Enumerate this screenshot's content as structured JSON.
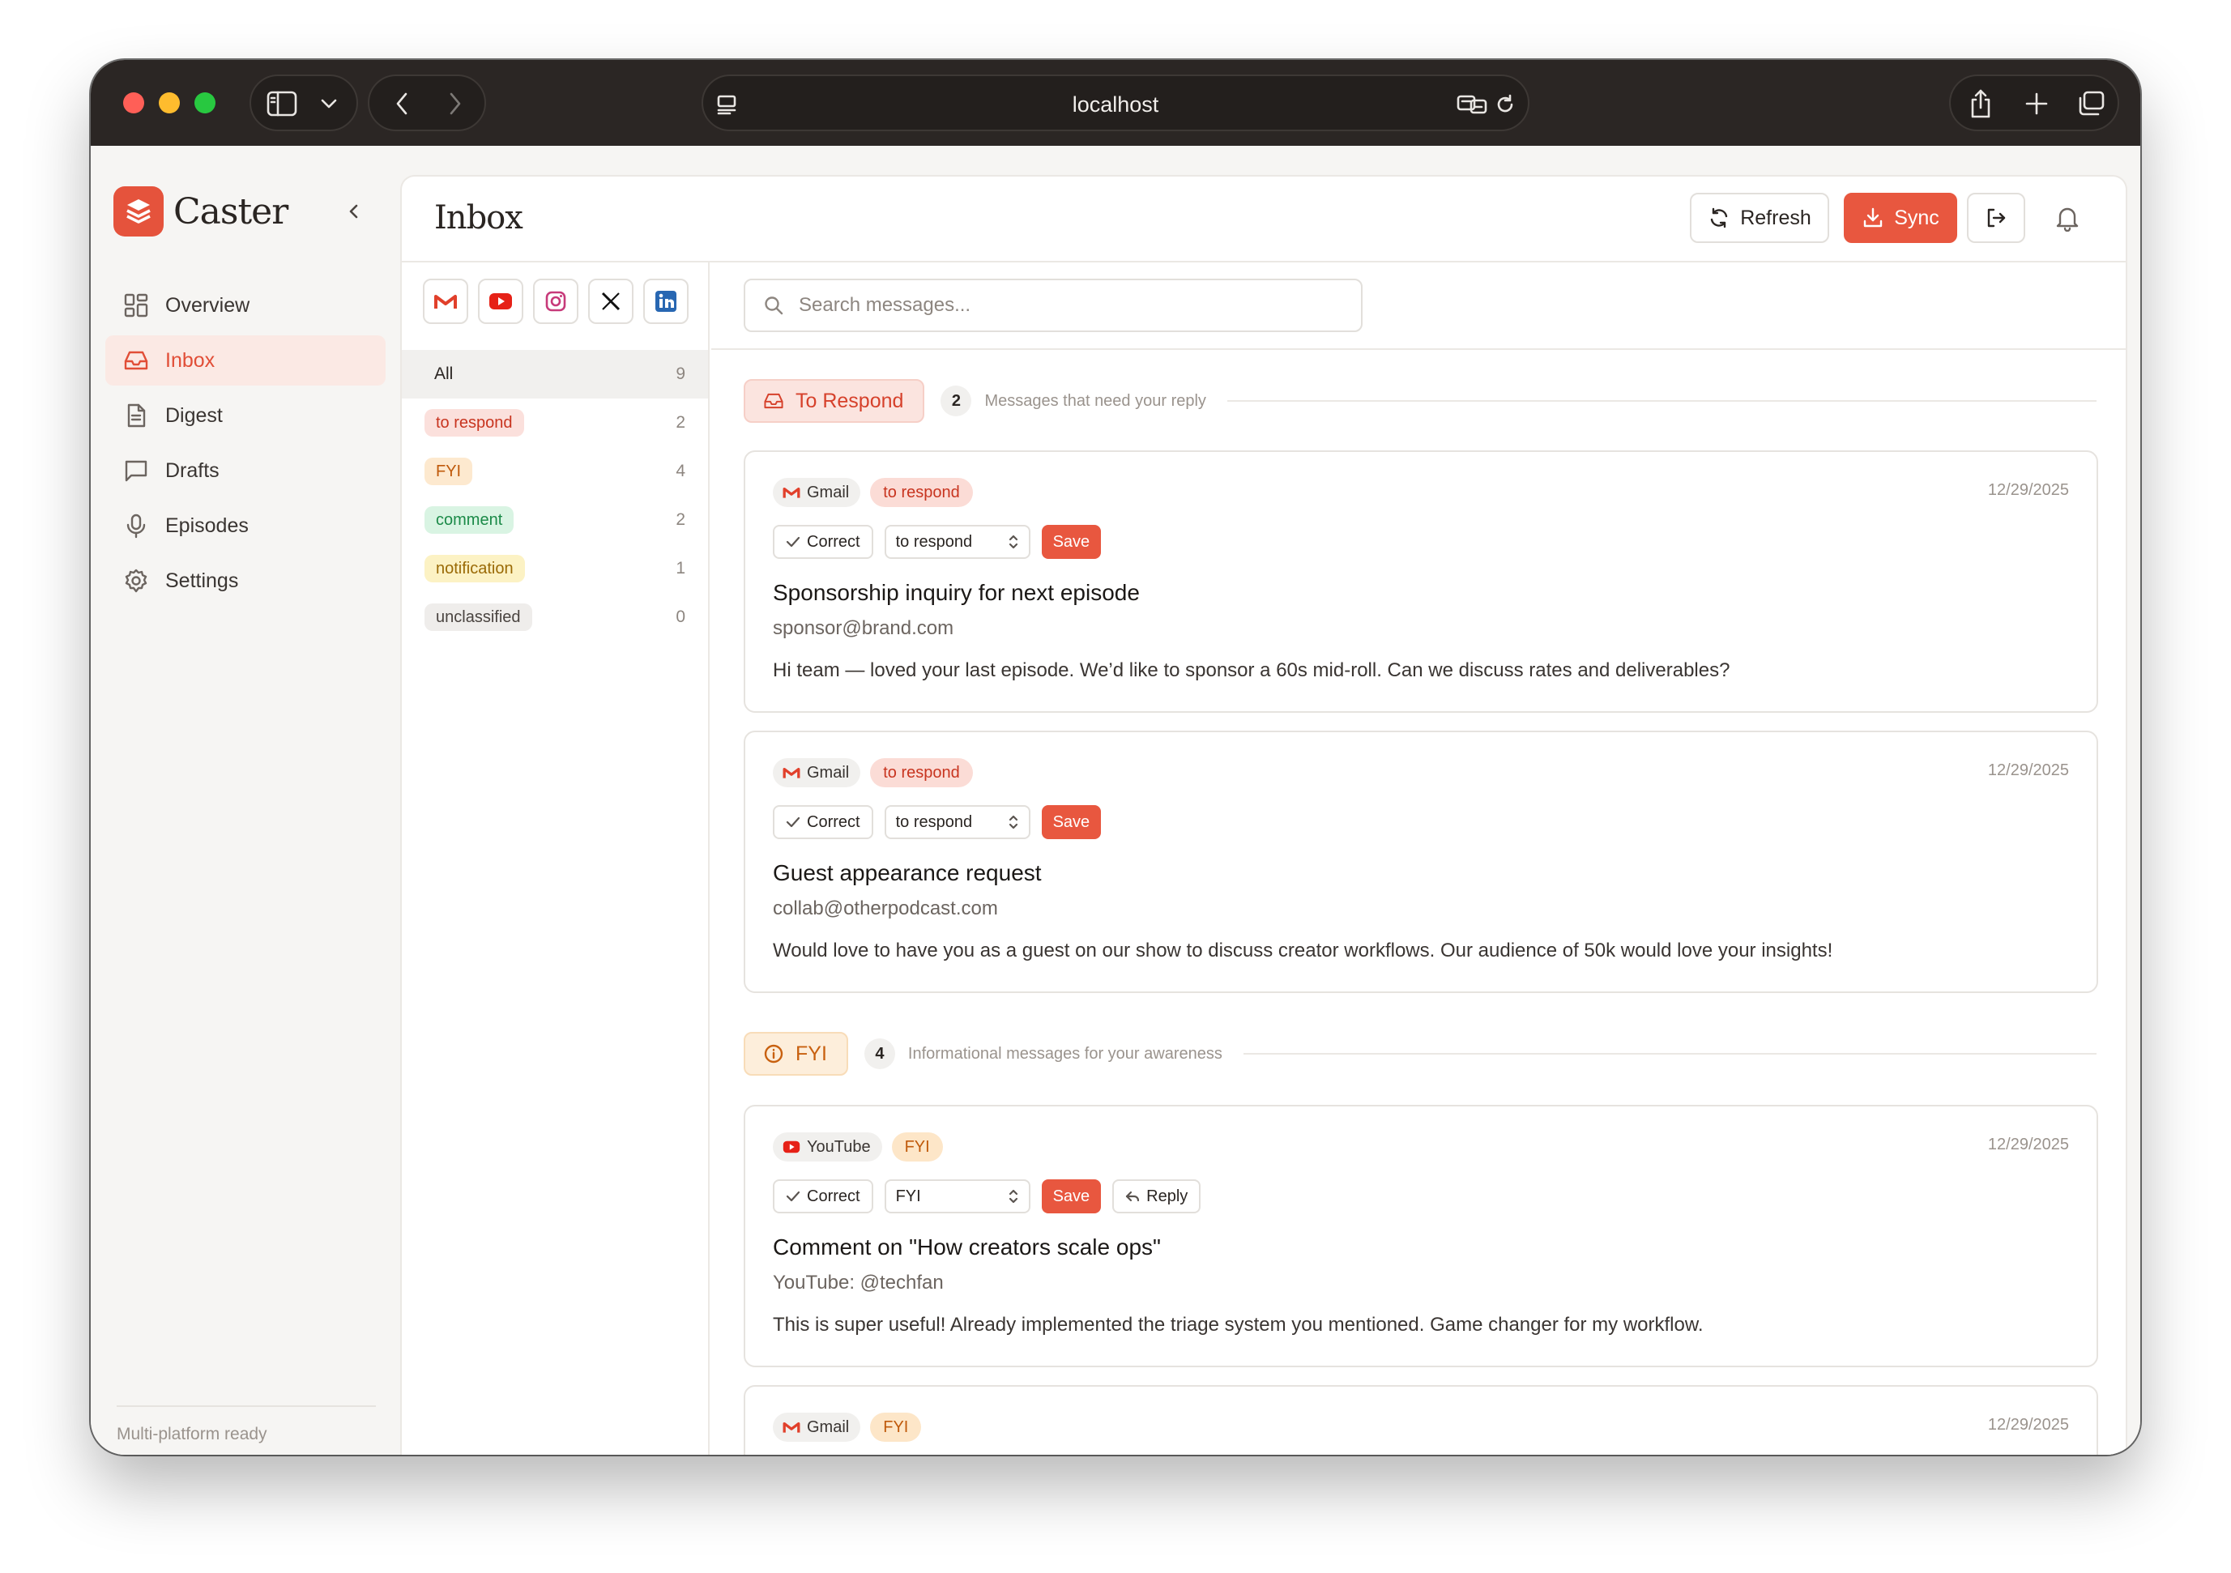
{
  "browser": {
    "url": "localhost"
  },
  "sidebar": {
    "brand": "Caster",
    "items": [
      {
        "label": "Overview",
        "icon": "grid-icon"
      },
      {
        "label": "Inbox",
        "icon": "inbox-icon",
        "active": true
      },
      {
        "label": "Digest",
        "icon": "document-icon"
      },
      {
        "label": "Drafts",
        "icon": "message-square-icon"
      },
      {
        "label": "Episodes",
        "icon": "microphone-icon"
      },
      {
        "label": "Settings",
        "icon": "gear-icon"
      }
    ],
    "footer": "Multi-platform ready"
  },
  "header": {
    "title": "Inbox",
    "refresh_label": "Refresh",
    "sync_label": "Sync"
  },
  "platforms": [
    "gmail-icon",
    "youtube-icon",
    "instagram-icon",
    "x-icon",
    "linkedin-icon"
  ],
  "filters": [
    {
      "label": "All",
      "count": "9"
    },
    {
      "label": "to respond",
      "count": "2"
    },
    {
      "label": "FYI",
      "count": "4"
    },
    {
      "label": "comment",
      "count": "2"
    },
    {
      "label": "notification",
      "count": "1"
    },
    {
      "label": "unclassified",
      "count": "0"
    }
  ],
  "search": {
    "placeholder": "Search messages..."
  },
  "sections": [
    {
      "label": "To Respond",
      "count": "2",
      "description": "Messages that need your reply"
    },
    {
      "label": "FYI",
      "count": "4",
      "description": "Informational messages for your awareness"
    }
  ],
  "messages": [
    {
      "source": "Gmail",
      "tag": "to respond",
      "date": "12/29/2025",
      "correct_label": "Correct",
      "select_value": "to respond",
      "save_label": "Save",
      "subject": "Sponsorship inquiry for next episode",
      "sender": "sponsor@brand.com",
      "body": "Hi team — loved your last episode. We’d like to sponsor a 60s mid-roll. Can we discuss rates and deliverables?"
    },
    {
      "source": "Gmail",
      "tag": "to respond",
      "date": "12/29/2025",
      "correct_label": "Correct",
      "select_value": "to respond",
      "save_label": "Save",
      "subject": "Guest appearance request",
      "sender": "collab@otherpodcast.com",
      "body": "Would love to have you as a guest on our show to discuss creator workflows. Our audience of 50k would love your insights!"
    },
    {
      "source": "YouTube",
      "tag": "FYI",
      "date": "12/29/2025",
      "correct_label": "Correct",
      "select_value": "FYI",
      "save_label": "Save",
      "reply_label": "Reply",
      "subject": "Comment on \"How creators scale ops\"",
      "sender": "YouTube: @techfan",
      "body": "This is super useful! Already implemented the triage system you mentioned. Game changer for my workflow."
    },
    {
      "source": "Gmail",
      "tag": "FYI",
      "date": "12/29/2025"
    }
  ],
  "colors": {
    "accent": "#e8573f",
    "respond_bg": "#fbe0dc",
    "fyi_bg": "#fde9cf",
    "comment_bg": "#d9f4e3",
    "notification_bg": "#fcf2c4"
  }
}
